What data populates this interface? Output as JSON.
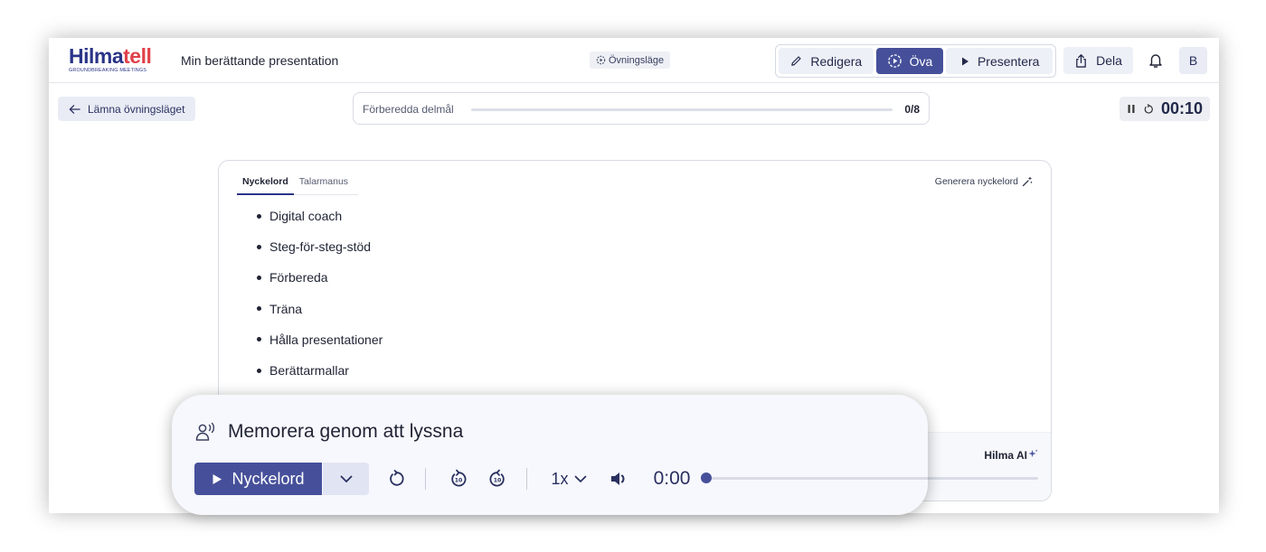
{
  "header": {
    "logo_part1": "Hilma",
    "logo_part2": "tell",
    "logo_tagline": "GROUNDBREAKING MEETINGS",
    "doc_title": "Min berättande presentation",
    "mode_badge": "Övningsläge",
    "mode_buttons": [
      {
        "label": "Redigera",
        "icon": "pencil-icon",
        "active": false
      },
      {
        "label": "Öva",
        "icon": "practice-icon",
        "active": true
      },
      {
        "label": "Presentera",
        "icon": "play-icon",
        "active": false
      }
    ],
    "share_label": "Dela",
    "avatar_initial": "B"
  },
  "toolbar": {
    "leave_label": "Lämna övningsläget",
    "progress_label": "Förberedda delmål",
    "progress_count": "0/8",
    "progress_fraction": 0,
    "timer": "00:10"
  },
  "card": {
    "tabs": [
      {
        "label": "Nyckelord",
        "active": true
      },
      {
        "label": "Talarmanus",
        "active": false
      }
    ],
    "generate_label": "Generera nyckelord",
    "keywords": [
      "Digital coach",
      "Steg-för-steg-stöd",
      "Förbereda",
      "Träna",
      "Hålla presentationer",
      "Berättarmallar"
    ],
    "hilma_ai_label": "Hilma AI"
  },
  "audio_panel": {
    "title": "Memorera genom att lyssna",
    "play_label": "Nyckelord",
    "speed": "1x",
    "time": "0:00",
    "skip_back_seconds": "10",
    "skip_forward_seconds": "10"
  },
  "colors": {
    "accent": "#46509a",
    "logo_blue": "#2a3488",
    "logo_red": "#e0404a",
    "button_bg": "#eef0f7"
  }
}
